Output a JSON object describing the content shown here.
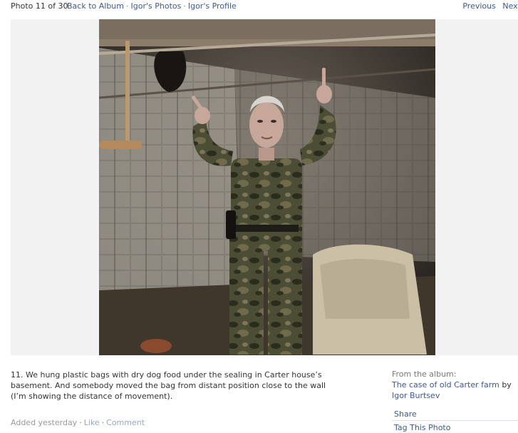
{
  "topbar": {
    "photo_count": "Photo 11 of 30",
    "back_to_album": "Back to Album",
    "igor_photos": "Igor's Photos",
    "igor_profile": "Igor's Profile",
    "separator": "·",
    "previous": "Previous",
    "next": "Next"
  },
  "caption": "11. We hung plastic bags with dry dog food under the sealing in Carter house’s basement. And somebody moved the bag from distant position close to the wall (I’m showing the distance of movement).",
  "meta": {
    "added": "Added yesterday",
    "separator": "·",
    "like": "Like",
    "comment": "Comment"
  },
  "sidebar": {
    "from_album_label": "From the album:",
    "album_title": "The case of old Carter farm",
    "by": "by",
    "author": "Igor Burtsev",
    "share": "Share",
    "tag_this_photo": "Tag This Photo"
  },
  "colors": {
    "link": "#3b5998",
    "stage_bg": "#f2f2f2",
    "text": "#333333",
    "muted": "#999999"
  }
}
